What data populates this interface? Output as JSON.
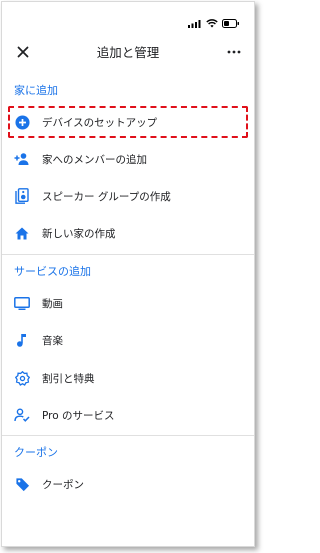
{
  "header": {
    "title": "追加と管理"
  },
  "sections": {
    "add_home": {
      "header": "家に追加",
      "items": [
        {
          "label": "デバイスのセットアップ",
          "icon": "add-circle-icon"
        },
        {
          "label": "家へのメンバーの追加",
          "icon": "person-add-icon"
        },
        {
          "label": "スピーカー グループの作成",
          "icon": "speaker-group-icon"
        },
        {
          "label": "新しい家の作成",
          "icon": "home-icon"
        }
      ]
    },
    "add_services": {
      "header": "サービスの追加",
      "items": [
        {
          "label": "動画",
          "icon": "tv-icon"
        },
        {
          "label": "音楽",
          "icon": "music-note-icon"
        },
        {
          "label": "割引と特典",
          "icon": "discount-badge-icon"
        },
        {
          "label": "Pro のサービス",
          "icon": "pro-services-icon"
        }
      ]
    },
    "coupons": {
      "header": "クーポン",
      "items": [
        {
          "label": "クーポン",
          "icon": "tag-icon"
        }
      ]
    }
  },
  "colors": {
    "accent": "#1a73e8",
    "highlight": "#e0101a",
    "text": "#202124"
  }
}
